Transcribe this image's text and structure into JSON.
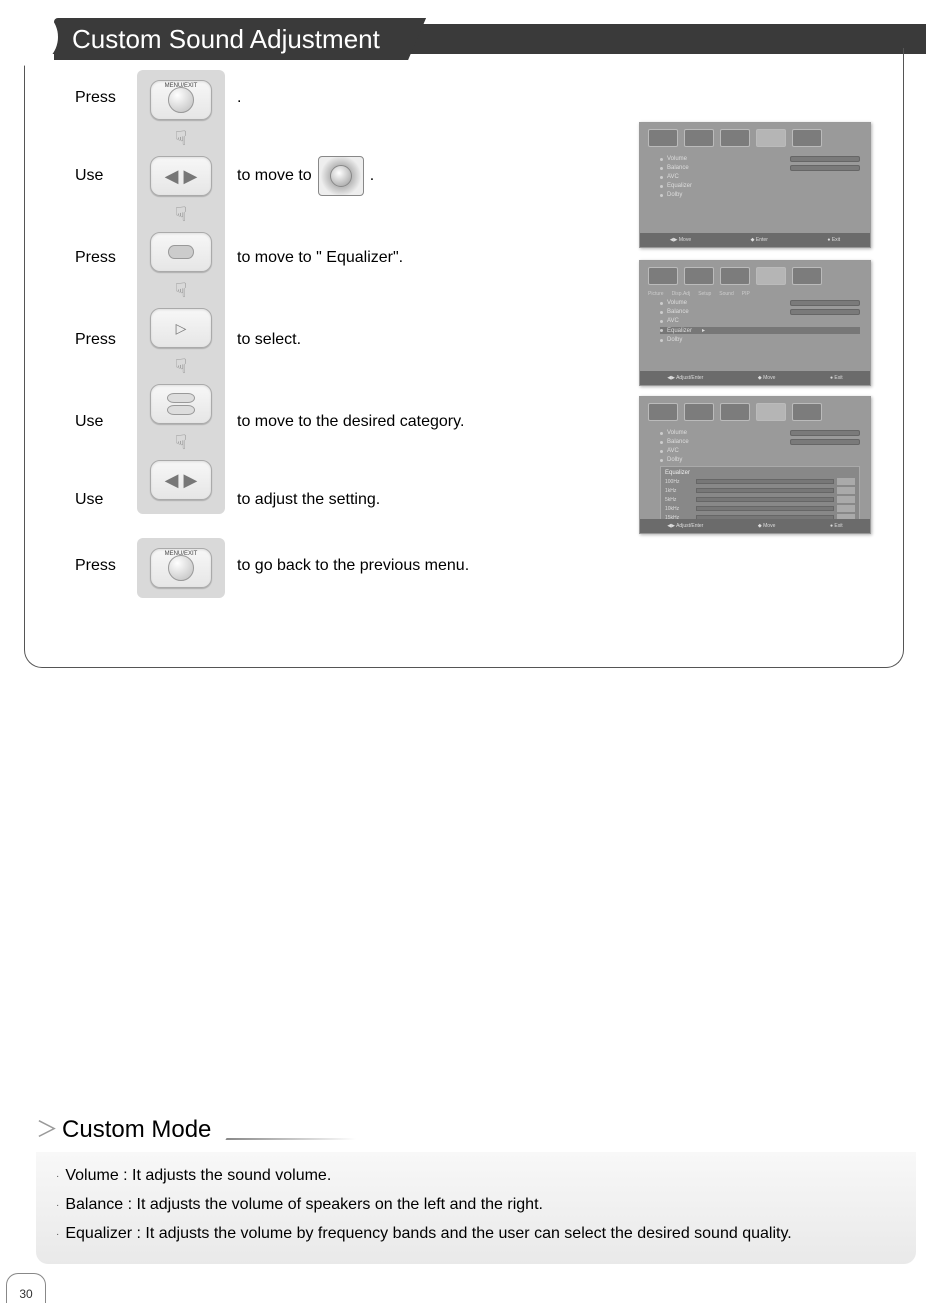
{
  "title": "Custom Sound Adjustment",
  "steps": {
    "s1": {
      "verb": "Press",
      "after": "."
    },
    "s2": {
      "verb": "Use",
      "after_pre": "to move to",
      "after_post": "."
    },
    "s3": {
      "verb": "Press",
      "after": "to move to \" Equalizer\"."
    },
    "s4": {
      "verb": "Press",
      "after": "to select."
    },
    "s5": {
      "verb": "Use",
      "after": "to move to the desired category."
    },
    "s6": {
      "verb": "Use",
      "after": "to adjust the setting."
    },
    "s7": {
      "verb": "Press",
      "after": "to go back to the previous menu."
    }
  },
  "button_labels": {
    "menu_exit": "MENU/EXIT"
  },
  "shots": {
    "menu1": {
      "items": [
        "Volume",
        "Balance",
        "AVC",
        "Equalizer",
        "Dolby"
      ],
      "footer": [
        "Move",
        "Enter",
        "Exit"
      ]
    },
    "menu2": {
      "tabs": [
        "Picture",
        "Disp.Adj",
        "Setup",
        "Sound",
        "PIP"
      ],
      "items": [
        "Volume",
        "Balance",
        "AVC",
        "Equalizer",
        "Dolby"
      ],
      "footer": [
        "Adjust/Enter",
        "Move",
        "Exit"
      ]
    },
    "menu3": {
      "items": [
        "Volume",
        "Balance",
        "AVC",
        "Equalizer",
        "Dolby"
      ],
      "popup_title": "Equalizer",
      "eq": [
        "100Hz",
        "1kHz",
        "5kHz",
        "10kHz",
        "15kHz"
      ],
      "footer_inner": [
        "Adjust",
        "Move",
        "Exit"
      ],
      "footer": [
        "Adjust/Enter",
        "Move",
        "Exit"
      ]
    }
  },
  "custom": {
    "heading": "Custom Mode",
    "lines": [
      "Volume : It adjusts the sound volume.",
      "Balance : It adjusts the volume of speakers on the left and the right.",
      "Equalizer : It adjusts the volume by frequency bands and the user can select the desired sound quality."
    ]
  },
  "page_number": "30"
}
